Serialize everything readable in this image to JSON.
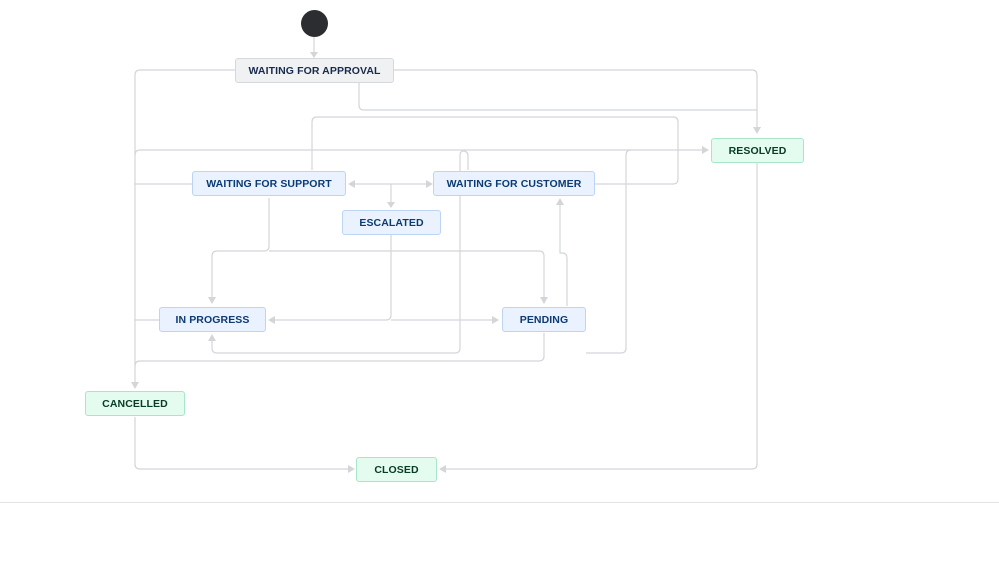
{
  "diagram": {
    "statuses": {
      "waiting_for_approval": "WAITING FOR APPROVAL",
      "resolved": "RESOLVED",
      "waiting_for_support": "WAITING FOR SUPPORT",
      "waiting_for_customer": "WAITING FOR CUSTOMER",
      "escalated": "ESCALATED",
      "in_progress": "IN PROGRESS",
      "pending": "PENDING",
      "cancelled": "CANCELLED",
      "closed": "CLOSED"
    },
    "colors": {
      "edge": "#d3d5d9",
      "todo_fill": "#f0f1f3",
      "inprogress_fill": "#e9f2fe",
      "done_fill": "#e3fcef",
      "start_node": "#2b2d31"
    }
  }
}
